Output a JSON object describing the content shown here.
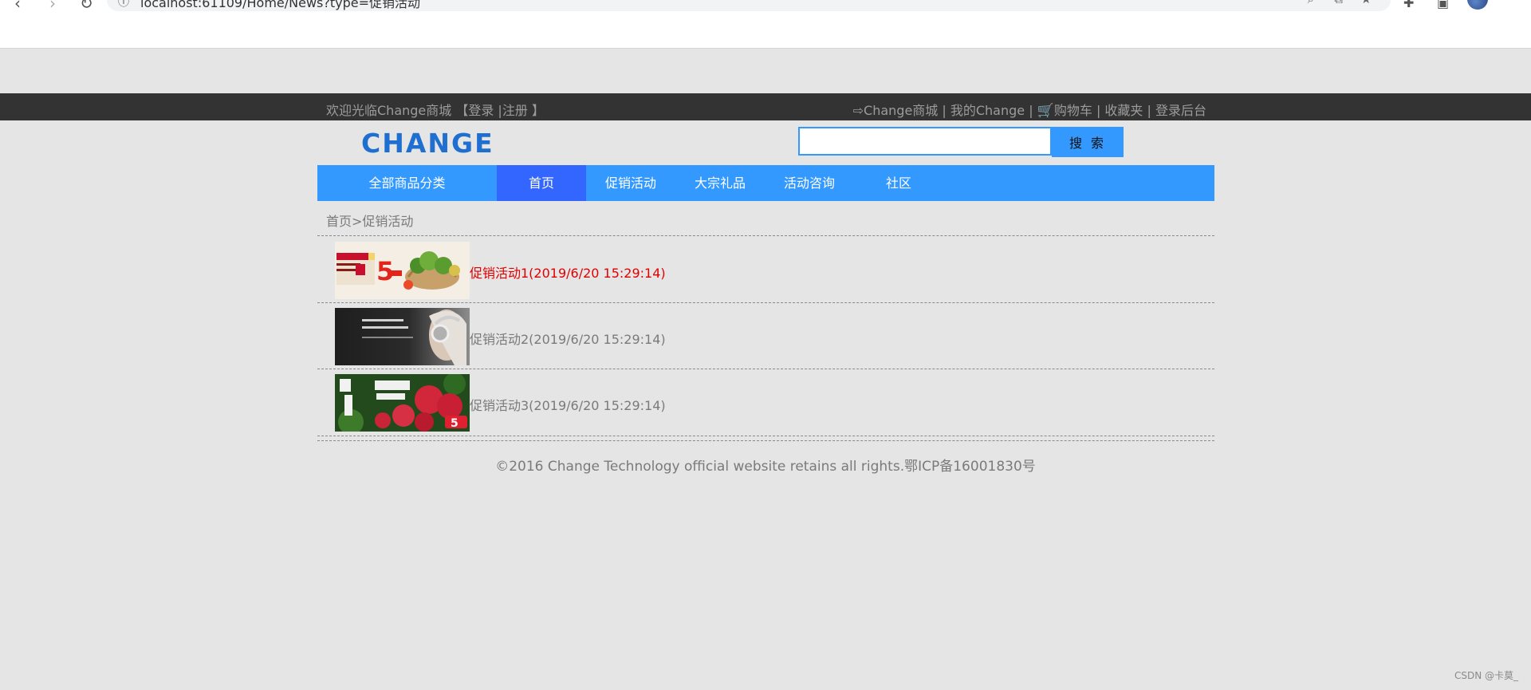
{
  "browser": {
    "url": "localhost:61109/Home/News?type=促销活动"
  },
  "topbar": {
    "welcome": "欢迎光临Change商城 【登录 |注册 】",
    "links_prefix": "⇨Change商城 | 我的Change | ",
    "cart_icon": "🛒",
    "links_suffix": "购物车 | 收藏夹 | 登录后台"
  },
  "logo": {
    "text": "CHANGE",
    "color": "#1f6fd1"
  },
  "search": {
    "value": "",
    "placeholder": "",
    "button": "搜 索"
  },
  "nav": {
    "items": [
      {
        "label": "全部商品分类"
      },
      {
        "label": "首页",
        "active": true
      },
      {
        "label": "促销活动"
      },
      {
        "label": "大宗礼品"
      },
      {
        "label": "活动咨询"
      },
      {
        "label": "社区"
      }
    ]
  },
  "breadcrumb": "首页>促销活动",
  "news": [
    {
      "title": "促销活动1(2019/6/20 15:29:14)",
      "highlighted": true
    },
    {
      "title": "促销活动2(2019/6/20 15:29:14)"
    },
    {
      "title": "促销活动3(2019/6/20 15:29:14)"
    }
  ],
  "footer": "©2016 Change Technology official website retains all rights.鄂ICP备16001830号",
  "watermark": "CSDN @卡莫_",
  "colors": {
    "topbar": "#333333",
    "nav": "#3399ff",
    "nav_active": "#3366ff",
    "highlight": "#e00000",
    "page_bg": "#e5e5e5"
  }
}
